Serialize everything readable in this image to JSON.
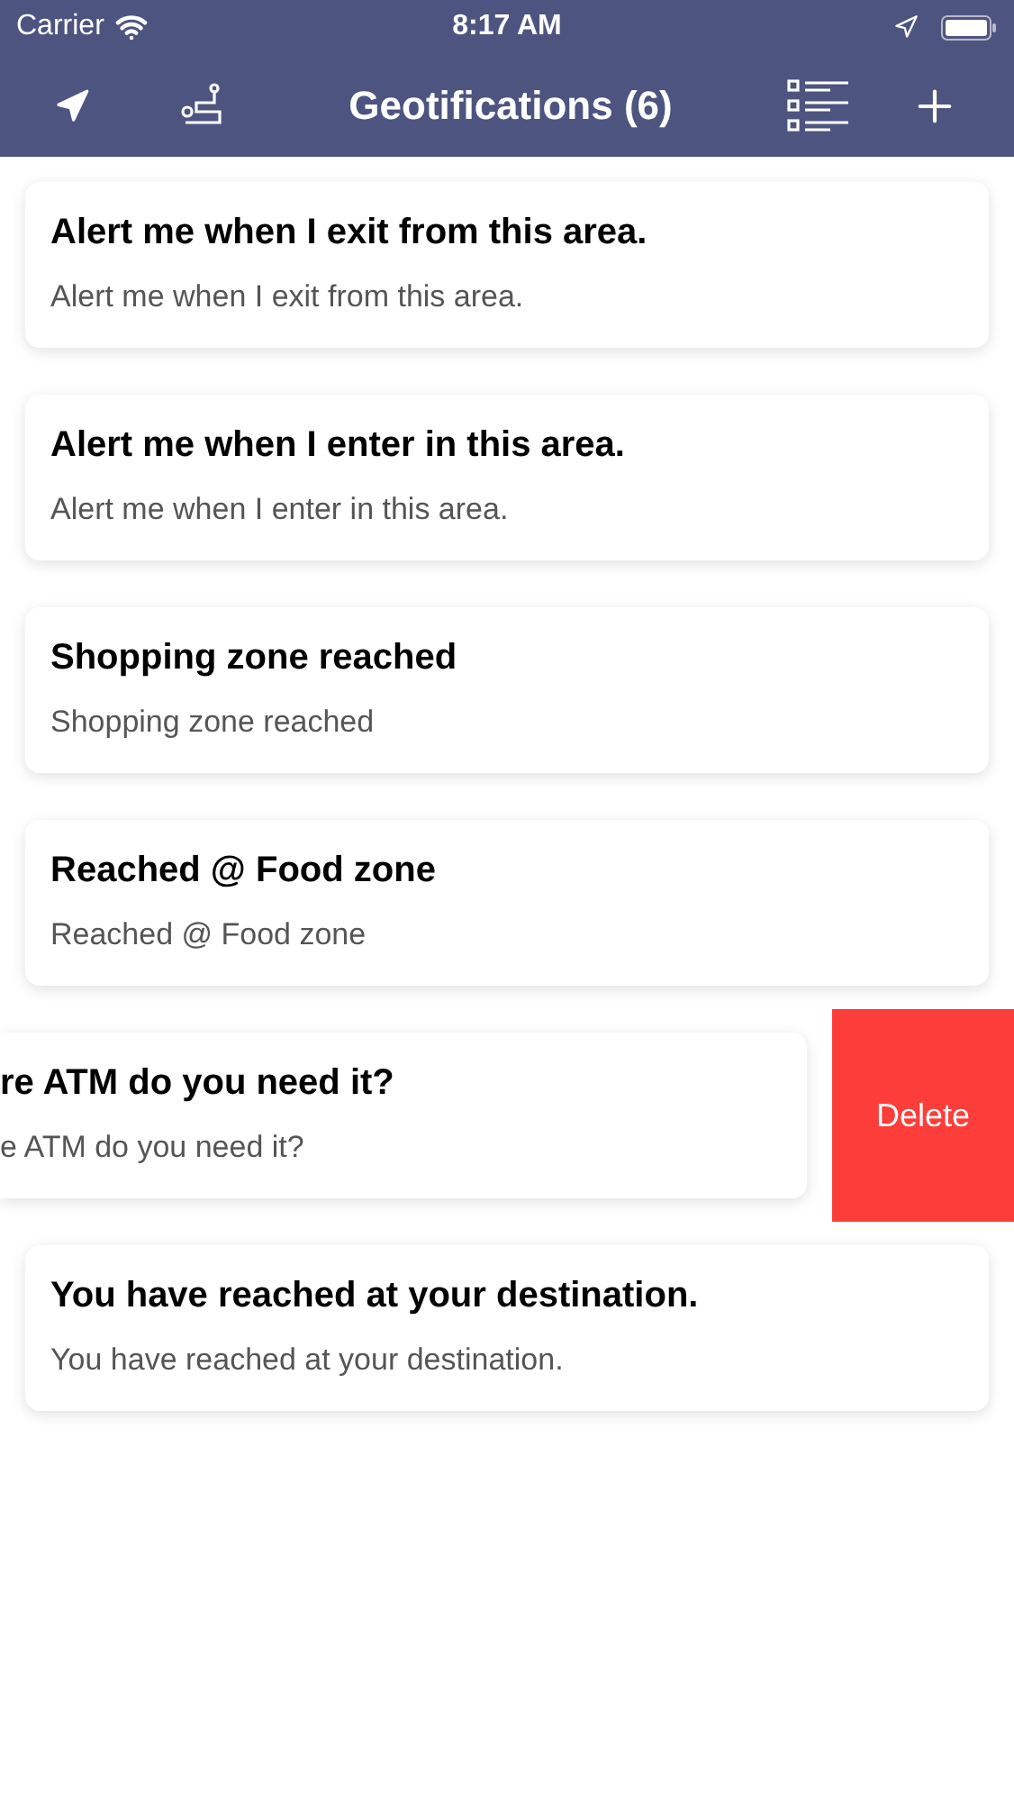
{
  "status_bar": {
    "carrier": "Carrier",
    "time": "8:17 AM"
  },
  "nav_bar": {
    "title": "Geotifications (6)"
  },
  "rows": [
    {
      "title": "Alert me when I exit from this area.",
      "subtitle": "Alert me when I exit from this area.",
      "swiped": false
    },
    {
      "title": "Alert  me when I enter in this area.",
      "subtitle": "Alert  me when I enter in this area.",
      "swiped": false
    },
    {
      "title": "Shopping zone reached",
      "subtitle": "Shopping zone reached",
      "swiped": false
    },
    {
      "title": "Reached @ Food zone",
      "subtitle": "Reached @ Food zone",
      "swiped": false
    },
    {
      "title": "re ATM do you need it?",
      "subtitle": "e ATM do you need it?",
      "swiped": true,
      "action": "Delete"
    },
    {
      "title": "You have reached at your destination.",
      "subtitle": "You have reached at your destination.",
      "swiped": false
    }
  ]
}
